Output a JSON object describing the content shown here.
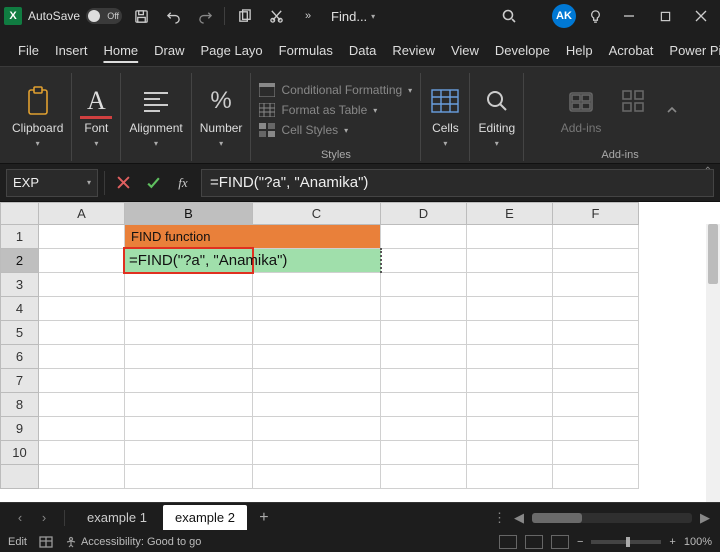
{
  "titlebar": {
    "autosave_label": "AutoSave",
    "autosave_state": "Off",
    "doc_title": "Find...",
    "avatar_initials": "AK"
  },
  "tabs": {
    "items": [
      {
        "label": "File"
      },
      {
        "label": "Insert"
      },
      {
        "label": "Home"
      },
      {
        "label": "Draw"
      },
      {
        "label": "Page Layo"
      },
      {
        "label": "Formulas"
      },
      {
        "label": "Data"
      },
      {
        "label": "Review"
      },
      {
        "label": "View"
      },
      {
        "label": "Develope"
      },
      {
        "label": "Help"
      },
      {
        "label": "Acrobat"
      },
      {
        "label": "Power Piv"
      }
    ],
    "active_index": 2
  },
  "ribbon": {
    "clipboard": "Clipboard",
    "font": "Font",
    "alignment": "Alignment",
    "number": "Number",
    "styles_group": "Styles",
    "cond_fmt": "Conditional Formatting",
    "fmt_table": "Format as Table",
    "cell_styles": "Cell Styles",
    "cells": "Cells",
    "editing": "Editing",
    "addins_btn": "Add-ins",
    "addins_group": "Add-ins"
  },
  "formula_bar": {
    "name_box": "EXP",
    "formula": "=FIND(\"?a\", \"Anamika\")"
  },
  "grid": {
    "columns": [
      "A",
      "B",
      "C",
      "D",
      "E",
      "F"
    ],
    "active_col_index": 1,
    "rows": [
      1,
      2,
      3,
      4,
      5,
      6,
      7,
      8,
      9,
      10
    ],
    "active_row_index": 1,
    "cells": {
      "B1": "FIND function",
      "B2": "=FIND(\"?a\", \"Anamika\")"
    }
  },
  "sheet_tabs": {
    "items": [
      {
        "label": "example 1"
      },
      {
        "label": "example 2"
      }
    ],
    "active_index": 1
  },
  "status": {
    "mode": "Edit",
    "accessibility": "Accessibility: Good to go",
    "zoom": "100%"
  }
}
